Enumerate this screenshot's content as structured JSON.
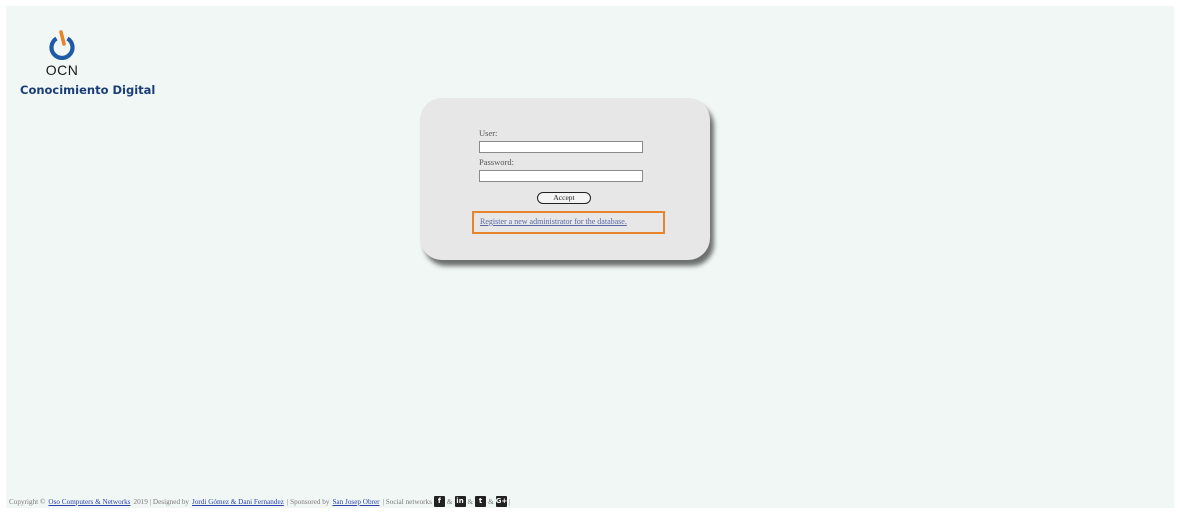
{
  "brand": {
    "name": "OCN",
    "subtitle": "Conocimiento Digital",
    "icon": "power-icon",
    "colors": {
      "ring": "#1f5aa6",
      "accent": "#e8842c"
    }
  },
  "login": {
    "user_label": "User:",
    "user_value": "",
    "password_label": "Password:",
    "password_value": "",
    "accept_label": "Accept",
    "register_link": "Register a new administrator for the database."
  },
  "footer": {
    "copyright_prefix": "Copyright ©",
    "company_link": "Oso Computers & Networks",
    "year_text": "2019 | Designed by",
    "designers_link": "Jordi Gómez & Dani Fernandez",
    "sponsored_text": "| Sponsored by",
    "sponsor_link": "San Josep Obrer",
    "social_text": "| Social networks",
    "separator": "&",
    "end_pipe": "|",
    "social": [
      {
        "icon": "facebook-icon",
        "glyph": "f"
      },
      {
        "icon": "linkedin-icon",
        "glyph": "in"
      },
      {
        "icon": "twitter-icon",
        "glyph": "t"
      },
      {
        "icon": "google-plus-icon",
        "glyph": "G+"
      }
    ]
  }
}
